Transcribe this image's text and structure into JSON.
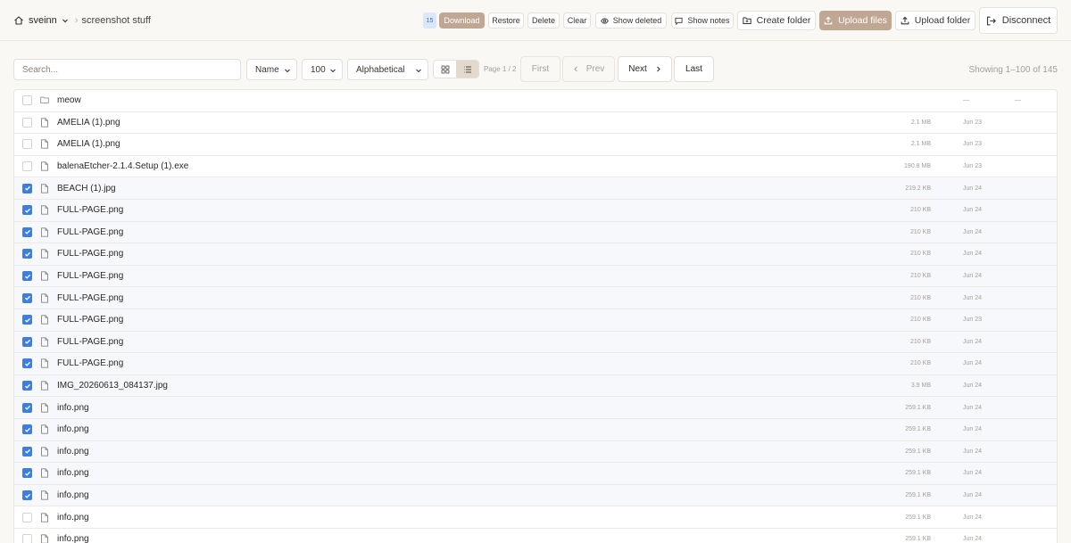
{
  "breadcrumb": {
    "user": "sveinn",
    "separator": "›",
    "folder": "screenshot stuff"
  },
  "actions": {
    "selected_count": "15",
    "download": "Download",
    "restore": "Restore",
    "delete": "Delete",
    "clear": "Clear",
    "show_deleted": "Show deleted",
    "show_notes": "Show notes",
    "create_folder": "Create folder",
    "upload_files": "Upload files",
    "upload_folder": "Upload folder",
    "disconnect": "Disconnect"
  },
  "toolbar": {
    "search_placeholder": "Search...",
    "sort_field": "Name",
    "page_size": "100",
    "sort_order": "Alphabetical",
    "view_mode": "list",
    "page_info": "Page 1 / 2",
    "first": "First",
    "prev": "Prev",
    "next": "Next",
    "last": "Last",
    "showing": "Showing 1–100 of 145"
  },
  "files": [
    {
      "name": "meow",
      "type": "folder",
      "size": "—",
      "date": "",
      "extra": "—",
      "checked": false
    },
    {
      "name": "AMELIA (1).png",
      "type": "file",
      "size": "2.1 MB",
      "date": "Jun 23",
      "checked": false
    },
    {
      "name": "AMELIA (1).png",
      "type": "file",
      "size": "2.1 MB",
      "date": "Jun 23",
      "checked": false
    },
    {
      "name": "balenaEtcher-2.1.4.Setup (1).exe",
      "type": "file",
      "size": "190.8 MB",
      "date": "Jun 23",
      "checked": false
    },
    {
      "name": "BEACH (1).jpg",
      "type": "file",
      "size": "219.2 KB",
      "date": "Jun 24",
      "checked": true
    },
    {
      "name": "FULL-PAGE.png",
      "type": "file",
      "size": "210 KB",
      "date": "Jun 24",
      "checked": true
    },
    {
      "name": "FULL-PAGE.png",
      "type": "file",
      "size": "210 KB",
      "date": "Jun 24",
      "checked": true
    },
    {
      "name": "FULL-PAGE.png",
      "type": "file",
      "size": "210 KB",
      "date": "Jun 24",
      "checked": true
    },
    {
      "name": "FULL-PAGE.png",
      "type": "file",
      "size": "210 KB",
      "date": "Jun 24",
      "checked": true
    },
    {
      "name": "FULL-PAGE.png",
      "type": "file",
      "size": "210 KB",
      "date": "Jun 24",
      "checked": true
    },
    {
      "name": "FULL-PAGE.png",
      "type": "file",
      "size": "210 KB",
      "date": "Jun 23",
      "checked": true
    },
    {
      "name": "FULL-PAGE.png",
      "type": "file",
      "size": "210 KB",
      "date": "Jun 24",
      "checked": true
    },
    {
      "name": "FULL-PAGE.png",
      "type": "file",
      "size": "210 KB",
      "date": "Jun 24",
      "checked": true
    },
    {
      "name": "IMG_20260613_084137.jpg",
      "type": "file",
      "size": "3.9 MB",
      "date": "Jun 24",
      "checked": true
    },
    {
      "name": "info.png",
      "type": "file",
      "size": "259.1 KB",
      "date": "Jun 24",
      "checked": true
    },
    {
      "name": "info.png",
      "type": "file",
      "size": "259.1 KB",
      "date": "Jun 24",
      "checked": true
    },
    {
      "name": "info.png",
      "type": "file",
      "size": "259.1 KB",
      "date": "Jun 24",
      "checked": true
    },
    {
      "name": "info.png",
      "type": "file",
      "size": "259.1 KB",
      "date": "Jun 24",
      "checked": true
    },
    {
      "name": "info.png",
      "type": "file",
      "size": "259.1 KB",
      "date": "Jun 24",
      "checked": true
    },
    {
      "name": "info.png",
      "type": "file",
      "size": "259.1 KB",
      "date": "Jun 24",
      "checked": false
    },
    {
      "name": "info.png",
      "type": "file",
      "size": "259.1 KB",
      "date": "Jun 24",
      "checked": false
    }
  ]
}
